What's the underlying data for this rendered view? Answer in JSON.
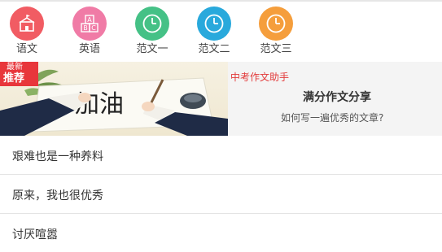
{
  "categories": [
    {
      "label": "语文",
      "icon": "school-icon",
      "color": "#f15c63"
    },
    {
      "label": "英语",
      "icon": "abc-blocks-icon",
      "color": "#f07ba6"
    },
    {
      "label": "范文一",
      "icon": "clock-icon",
      "color": "#45c186"
    },
    {
      "label": "范文二",
      "icon": "clock-icon",
      "color": "#29a9dc"
    },
    {
      "label": "范文三",
      "icon": "clock-icon",
      "color": "#f59e3c"
    }
  ],
  "banner": {
    "badge_top": "最新",
    "badge_bottom": "推荐",
    "image_text": "加油",
    "subtitle": "中考作文助手",
    "title": "满分作文分享",
    "description": "如何写一遍优秀的文章?"
  },
  "articles": [
    {
      "title": "艰难也是一种养料"
    },
    {
      "title": "原来，我也很优秀"
    },
    {
      "title": "讨厌喧嚣"
    }
  ]
}
